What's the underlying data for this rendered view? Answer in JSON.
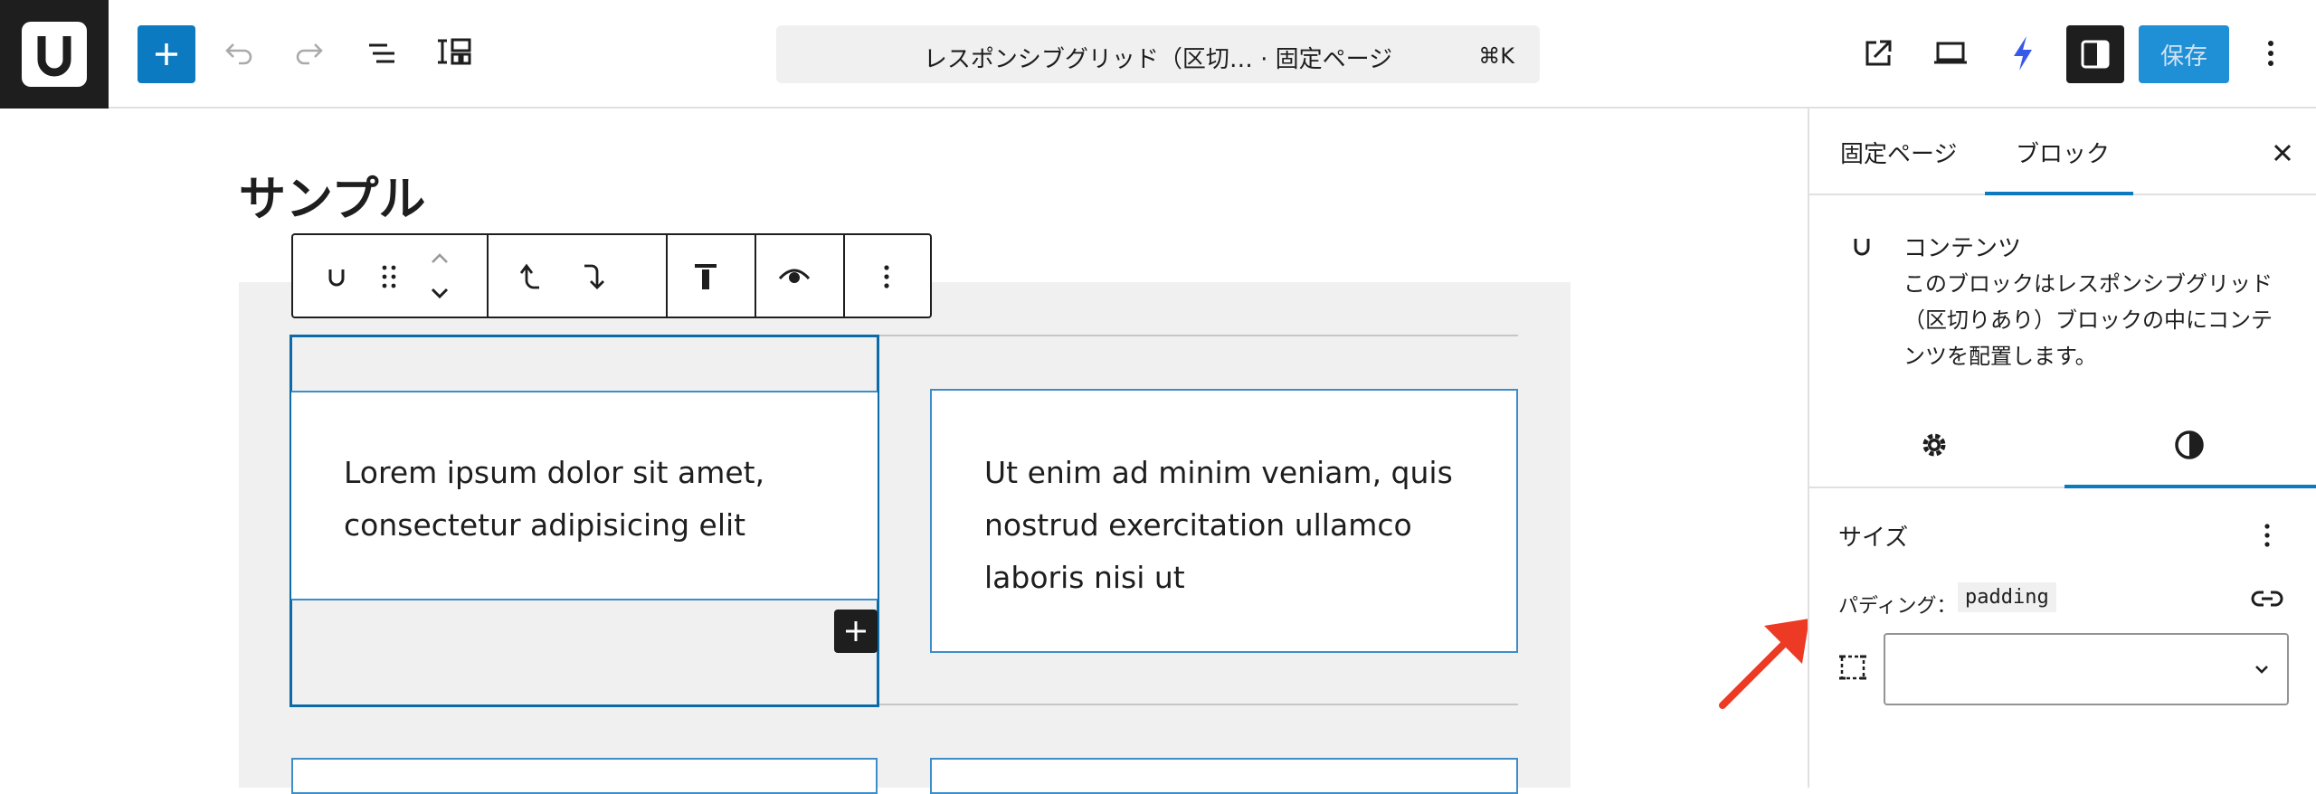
{
  "header": {
    "logo_letter": "U",
    "command_title": "レスポンシブグリッド（区切… · 固定ページ",
    "command_shortcut": "⌘K",
    "save_label": "保存",
    "icons": [
      "plus-icon",
      "undo-icon",
      "redo-icon",
      "list-view-icon",
      "block-inserter-icon",
      "external-link-icon",
      "device-preview-icon",
      "lightning-icon",
      "sidebar-icon",
      "more-vertical-icon"
    ],
    "colors": {
      "accent": "#0b7ac0",
      "dark": "#1e1e1e"
    }
  },
  "canvas": {
    "page_title": "サンプル",
    "cards": [
      {
        "lines": [
          "Lorem ipsum dolor sit amet,",
          "consectetur adipisicing elit"
        ]
      },
      {
        "lines": [
          "Ut enim ad minim veniam, quis",
          "nostrud exercitation ullamco",
          "laboris nisi ut"
        ]
      }
    ],
    "block_toolbar_icons": [
      "block-icon",
      "drag-handle-icon",
      "move-up-icon",
      "move-down-icon",
      "arrow-up-icon",
      "arrow-down-icon",
      "align-top-icon",
      "eye-icon",
      "more-vertical-icon"
    ]
  },
  "sidebar": {
    "tabs": [
      "固定ページ",
      "ブロック"
    ],
    "active_tab": "ブロック",
    "block_name": "コンテンツ",
    "block_description": "このブロックはレスポンシブグリッド（区切りあり）ブロックの中にコンテンツを配置します。",
    "sub_tabs_icons": [
      "settings-icon",
      "styles-icon"
    ],
    "panel_title": "サイズ",
    "padding_label": "パディング：",
    "padding_code": "padding",
    "padding_value": ""
  }
}
